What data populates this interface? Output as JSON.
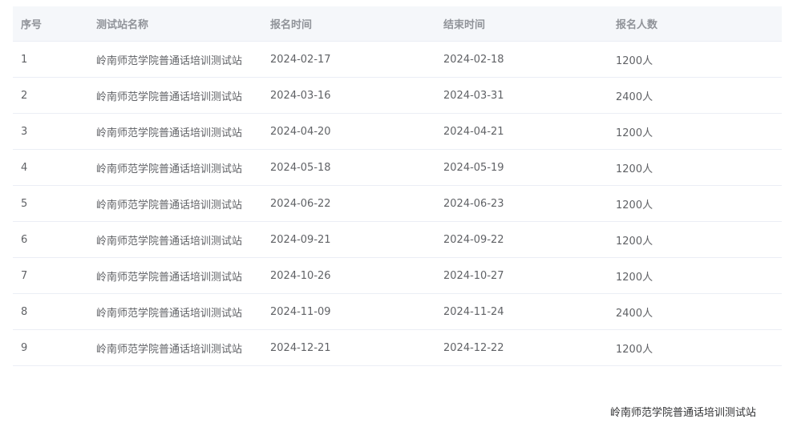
{
  "table": {
    "headers": {
      "index": "序号",
      "name": "测试站名称",
      "start": "报名时间",
      "end": "结束时间",
      "count": "报名人数"
    },
    "rows": [
      {
        "index": "1",
        "name": "岭南师范学院普通话培训测试站",
        "start": "2024-02-17",
        "end": "2024-02-18",
        "count": "1200人"
      },
      {
        "index": "2",
        "name": "岭南师范学院普通话培训测试站",
        "start": "2024-03-16",
        "end": "2024-03-31",
        "count": "2400人"
      },
      {
        "index": "3",
        "name": "岭南师范学院普通话培训测试站",
        "start": "2024-04-20",
        "end": "2024-04-21",
        "count": "1200人"
      },
      {
        "index": "4",
        "name": "岭南师范学院普通话培训测试站",
        "start": "2024-05-18",
        "end": "2024-05-19",
        "count": "1200人"
      },
      {
        "index": "5",
        "name": "岭南师范学院普通话培训测试站",
        "start": "2024-06-22",
        "end": "2024-06-23",
        "count": "1200人"
      },
      {
        "index": "6",
        "name": "岭南师范学院普通话培训测试站",
        "start": "2024-09-21",
        "end": "2024-09-22",
        "count": "1200人"
      },
      {
        "index": "7",
        "name": "岭南师范学院普通话培训测试站",
        "start": "2024-10-26",
        "end": "2024-10-27",
        "count": "1200人"
      },
      {
        "index": "8",
        "name": "岭南师范学院普通话培训测试站",
        "start": "2024-11-09",
        "end": "2024-11-24",
        "count": "2400人"
      },
      {
        "index": "9",
        "name": "岭南师范学院普通话培训测试站",
        "start": "2024-12-21",
        "end": "2024-12-22",
        "count": "1200人"
      }
    ]
  },
  "footer": {
    "text": "岭南师范学院普通话培训测试站"
  }
}
